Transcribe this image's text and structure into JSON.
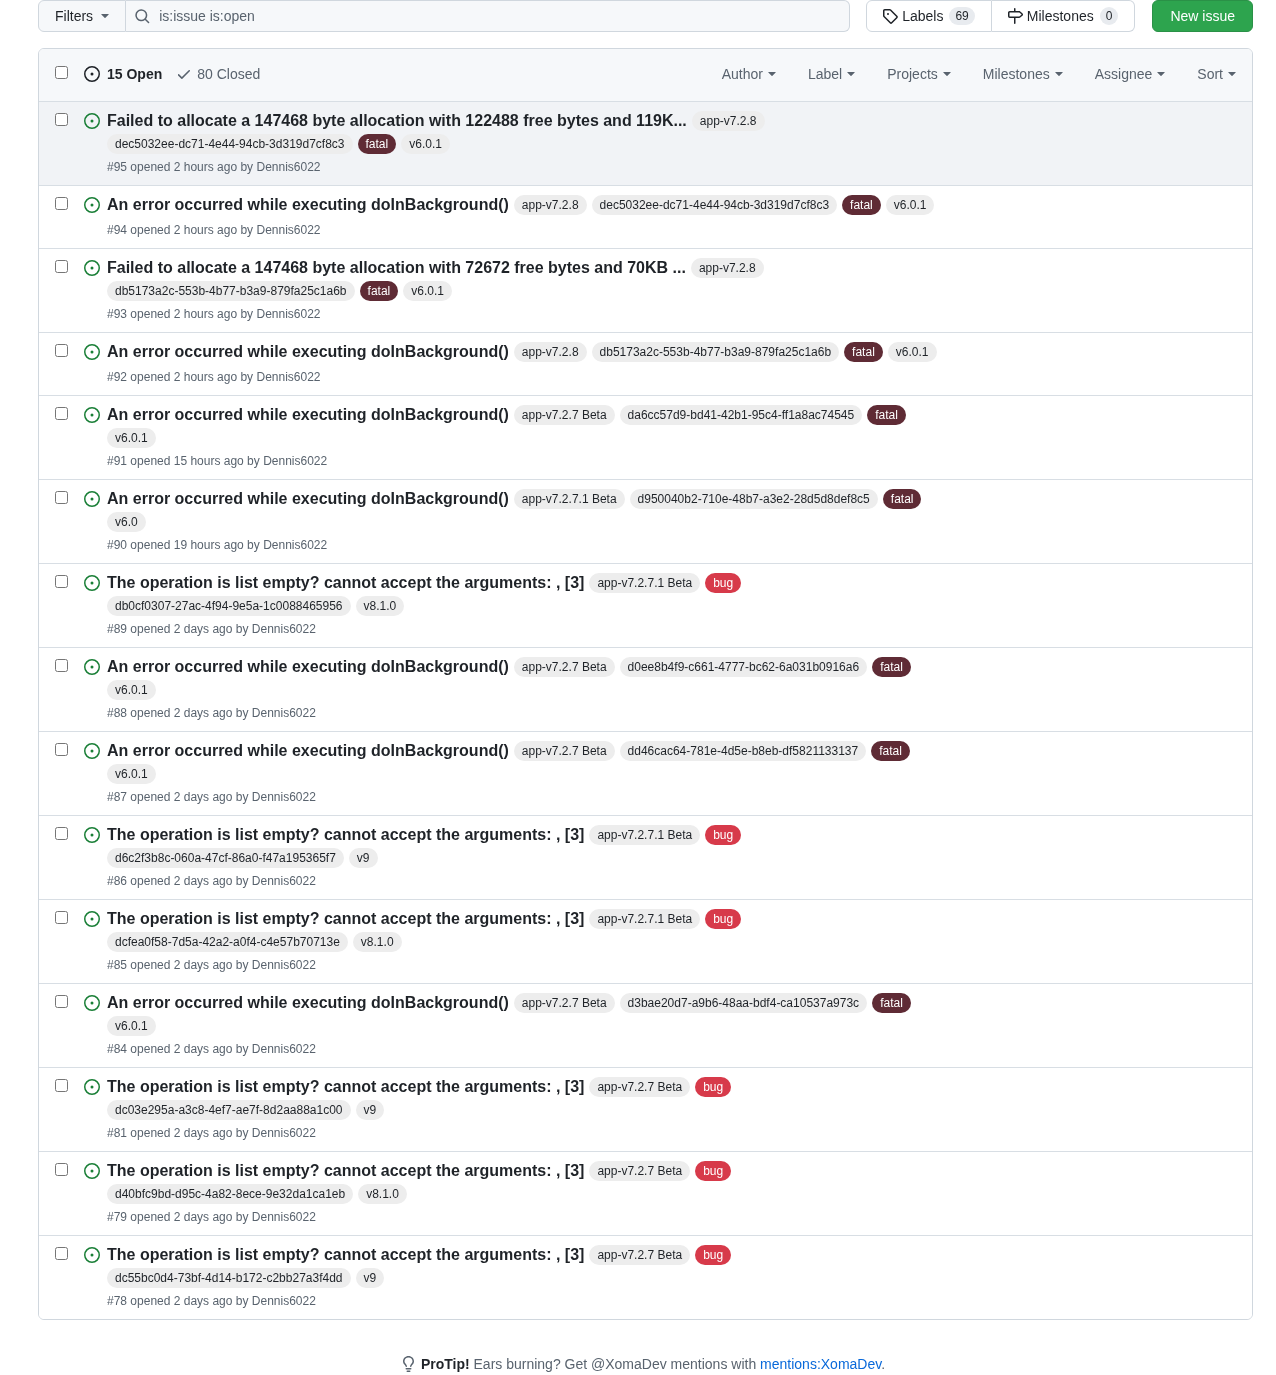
{
  "toolbar": {
    "filters_button": "Filters",
    "search": {
      "value": "is:issue is:open"
    },
    "labels_button": {
      "label": "Labels",
      "count": "69"
    },
    "milestones_button": {
      "label": "Milestones",
      "count": "0"
    },
    "new_issue_button": "New issue"
  },
  "header": {
    "select_all": {
      "checked": false
    },
    "states": [
      {
        "kind": "open",
        "label": "15 Open",
        "selected": true
      },
      {
        "kind": "closed",
        "label": "80 Closed",
        "selected": false
      }
    ],
    "filters": [
      "Author",
      "Label",
      "Projects",
      "Milestones",
      "Assignee",
      "Sort"
    ]
  },
  "issues": [
    {
      "title": "Failed to allocate a 147468 byte allocation with 122488 free bytes and 119K...",
      "labels": [
        {
          "text": "app-v7.2.8",
          "color": "#ededed"
        },
        {
          "text": "dec5032ee-dc71-4e44-94cb-3d319d7cf8c3",
          "color": "#ededed"
        },
        {
          "text": "fatal",
          "color": "#5f2b35"
        },
        {
          "text": "v6.0.1",
          "color": "#ededed"
        }
      ],
      "meta": "#95 opened 2 hours ago by",
      "author": "Dennis6022",
      "checked": false,
      "highlighted": true
    },
    {
      "title": "An error occurred while executing doInBackground()",
      "labels": [
        {
          "text": "app-v7.2.8",
          "color": "#ededed"
        },
        {
          "text": "dec5032ee-dc71-4e44-94cb-3d319d7cf8c3",
          "color": "#ededed"
        },
        {
          "text": "fatal",
          "color": "#5f2b35"
        },
        {
          "text": "v6.0.1",
          "color": "#ededed"
        }
      ],
      "meta": "#94 opened 2 hours ago by",
      "author": "Dennis6022",
      "checked": false,
      "highlighted": false
    },
    {
      "title": "Failed to allocate a 147468 byte allocation with 72672 free bytes and 70KB ...",
      "labels": [
        {
          "text": "app-v7.2.8",
          "color": "#ededed"
        },
        {
          "text": "db5173a2c-553b-4b77-b3a9-879fa25c1a6b",
          "color": "#ededed"
        },
        {
          "text": "fatal",
          "color": "#5f2b35"
        },
        {
          "text": "v6.0.1",
          "color": "#ededed"
        }
      ],
      "meta": "#93 opened 2 hours ago by",
      "author": "Dennis6022",
      "checked": false,
      "highlighted": false
    },
    {
      "title": "An error occurred while executing doInBackground()",
      "labels": [
        {
          "text": "app-v7.2.8",
          "color": "#ededed"
        },
        {
          "text": "db5173a2c-553b-4b77-b3a9-879fa25c1a6b",
          "color": "#ededed"
        },
        {
          "text": "fatal",
          "color": "#5f2b35"
        },
        {
          "text": "v6.0.1",
          "color": "#ededed"
        }
      ],
      "meta": "#92 opened 2 hours ago by",
      "author": "Dennis6022",
      "checked": false,
      "highlighted": false
    },
    {
      "title": "An error occurred while executing doInBackground()",
      "labels": [
        {
          "text": "app-v7.2.7 Beta",
          "color": "#ededed"
        },
        {
          "text": "da6cc57d9-bd41-42b1-95c4-ff1a8ac74545",
          "color": "#ededed"
        },
        {
          "text": "fatal",
          "color": "#5f2b35"
        },
        {
          "text": "v6.0.1",
          "color": "#ededed"
        }
      ],
      "meta": "#91 opened 15 hours ago by",
      "author": "Dennis6022",
      "checked": false,
      "highlighted": false
    },
    {
      "title": "An error occurred while executing doInBackground()",
      "labels": [
        {
          "text": "app-v7.2.7.1 Beta",
          "color": "#ededed"
        },
        {
          "text": "d950040b2-710e-48b7-a3e2-28d5d8def8c5",
          "color": "#ededed"
        },
        {
          "text": "fatal",
          "color": "#5f2b35"
        },
        {
          "text": "v6.0",
          "color": "#ededed"
        }
      ],
      "meta": "#90 opened 19 hours ago by",
      "author": "Dennis6022",
      "checked": false,
      "highlighted": false
    },
    {
      "title": "The operation is list empty? cannot accept the arguments: , [3]",
      "labels": [
        {
          "text": "app-v7.2.7.1 Beta",
          "color": "#ededed"
        },
        {
          "text": "bug",
          "color": "#d73a4a"
        },
        {
          "text": "db0cf0307-27ac-4f94-9e5a-1c0088465956",
          "color": "#ededed"
        },
        {
          "text": "v8.1.0",
          "color": "#ededed"
        }
      ],
      "meta": "#89 opened 2 days ago by",
      "author": "Dennis6022",
      "checked": false,
      "highlighted": false
    },
    {
      "title": "An error occurred while executing doInBackground()",
      "labels": [
        {
          "text": "app-v7.2.7 Beta",
          "color": "#ededed"
        },
        {
          "text": "d0ee8b4f9-c661-4777-bc62-6a031b0916a6",
          "color": "#ededed"
        },
        {
          "text": "fatal",
          "color": "#5f2b35"
        },
        {
          "text": "v6.0.1",
          "color": "#ededed"
        }
      ],
      "meta": "#88 opened 2 days ago by",
      "author": "Dennis6022",
      "checked": false,
      "highlighted": false
    },
    {
      "title": "An error occurred while executing doInBackground()",
      "labels": [
        {
          "text": "app-v7.2.7 Beta",
          "color": "#ededed"
        },
        {
          "text": "dd46cac64-781e-4d5e-b8eb-df5821133137",
          "color": "#ededed"
        },
        {
          "text": "fatal",
          "color": "#5f2b35"
        },
        {
          "text": "v6.0.1",
          "color": "#ededed"
        }
      ],
      "meta": "#87 opened 2 days ago by",
      "author": "Dennis6022",
      "checked": false,
      "highlighted": false
    },
    {
      "title": "The operation is list empty? cannot accept the arguments: , [3]",
      "labels": [
        {
          "text": "app-v7.2.7.1 Beta",
          "color": "#ededed"
        },
        {
          "text": "bug",
          "color": "#d73a4a"
        },
        {
          "text": "d6c2f3b8c-060a-47cf-86a0-f47a195365f7",
          "color": "#ededed"
        },
        {
          "text": "v9",
          "color": "#ededed"
        }
      ],
      "meta": "#86 opened 2 days ago by",
      "author": "Dennis6022",
      "checked": false,
      "highlighted": false
    },
    {
      "title": "The operation is list empty? cannot accept the arguments: , [3]",
      "labels": [
        {
          "text": "app-v7.2.7.1 Beta",
          "color": "#ededed"
        },
        {
          "text": "bug",
          "color": "#d73a4a"
        },
        {
          "text": "dcfea0f58-7d5a-42a2-a0f4-c4e57b70713e",
          "color": "#ededed"
        },
        {
          "text": "v8.1.0",
          "color": "#ededed"
        }
      ],
      "meta": "#85 opened 2 days ago by",
      "author": "Dennis6022",
      "checked": false,
      "highlighted": false
    },
    {
      "title": "An error occurred while executing doInBackground()",
      "labels": [
        {
          "text": "app-v7.2.7 Beta",
          "color": "#ededed"
        },
        {
          "text": "d3bae20d7-a9b6-48aa-bdf4-ca10537a973c",
          "color": "#ededed"
        },
        {
          "text": "fatal",
          "color": "#5f2b35"
        },
        {
          "text": "v6.0.1",
          "color": "#ededed"
        }
      ],
      "meta": "#84 opened 2 days ago by",
      "author": "Dennis6022",
      "checked": false,
      "highlighted": false
    },
    {
      "title": "The operation is list empty? cannot accept the arguments: , [3]",
      "labels": [
        {
          "text": "app-v7.2.7 Beta",
          "color": "#ededed"
        },
        {
          "text": "bug",
          "color": "#d73a4a"
        },
        {
          "text": "dc03e295a-a3c8-4ef7-ae7f-8d2aa88a1c00",
          "color": "#ededed"
        },
        {
          "text": "v9",
          "color": "#ededed"
        }
      ],
      "meta": "#81 opened 2 days ago by",
      "author": "Dennis6022",
      "checked": false,
      "highlighted": false
    },
    {
      "title": "The operation is list empty? cannot accept the arguments: , [3]",
      "labels": [
        {
          "text": "app-v7.2.7 Beta",
          "color": "#ededed"
        },
        {
          "text": "bug",
          "color": "#d73a4a"
        },
        {
          "text": "d40bfc9bd-d95c-4a82-8ece-9e32da1ca1eb",
          "color": "#ededed"
        },
        {
          "text": "v8.1.0",
          "color": "#ededed"
        }
      ],
      "meta": "#79 opened 2 days ago by",
      "author": "Dennis6022",
      "checked": false,
      "highlighted": false
    },
    {
      "title": "The operation is list empty? cannot accept the arguments: , [3]",
      "labels": [
        {
          "text": "app-v7.2.7 Beta",
          "color": "#ededed"
        },
        {
          "text": "bug",
          "color": "#d73a4a"
        },
        {
          "text": "dc55bc0d4-73bf-4d14-b172-c2bb27a3f4dd",
          "color": "#ededed"
        },
        {
          "text": "v9",
          "color": "#ededed"
        }
      ],
      "meta": "#78 opened 2 days ago by",
      "author": "Dennis6022",
      "checked": false,
      "highlighted": false
    }
  ],
  "protip": {
    "text": "**ProTip!** Ears burning? Get @XomaDev mentions with",
    "link": "mentions:XomaDev",
    "after": "."
  }
}
